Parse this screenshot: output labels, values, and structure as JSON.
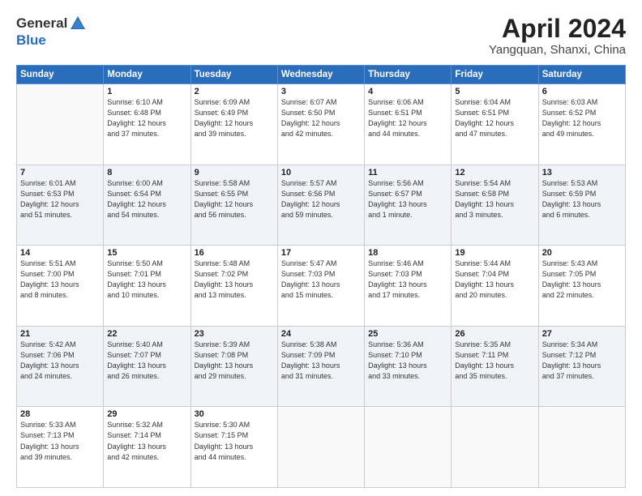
{
  "logo": {
    "general": "General",
    "blue": "Blue"
  },
  "header": {
    "month": "April 2024",
    "location": "Yangquan, Shanxi, China"
  },
  "weekdays": [
    "Sunday",
    "Monday",
    "Tuesday",
    "Wednesday",
    "Thursday",
    "Friday",
    "Saturday"
  ],
  "weeks": [
    [
      {
        "day": "",
        "info": ""
      },
      {
        "day": "1",
        "info": "Sunrise: 6:10 AM\nSunset: 6:48 PM\nDaylight: 12 hours\nand 37 minutes."
      },
      {
        "day": "2",
        "info": "Sunrise: 6:09 AM\nSunset: 6:49 PM\nDaylight: 12 hours\nand 39 minutes."
      },
      {
        "day": "3",
        "info": "Sunrise: 6:07 AM\nSunset: 6:50 PM\nDaylight: 12 hours\nand 42 minutes."
      },
      {
        "day": "4",
        "info": "Sunrise: 6:06 AM\nSunset: 6:51 PM\nDaylight: 12 hours\nand 44 minutes."
      },
      {
        "day": "5",
        "info": "Sunrise: 6:04 AM\nSunset: 6:51 PM\nDaylight: 12 hours\nand 47 minutes."
      },
      {
        "day": "6",
        "info": "Sunrise: 6:03 AM\nSunset: 6:52 PM\nDaylight: 12 hours\nand 49 minutes."
      }
    ],
    [
      {
        "day": "7",
        "info": "Sunrise: 6:01 AM\nSunset: 6:53 PM\nDaylight: 12 hours\nand 51 minutes."
      },
      {
        "day": "8",
        "info": "Sunrise: 6:00 AM\nSunset: 6:54 PM\nDaylight: 12 hours\nand 54 minutes."
      },
      {
        "day": "9",
        "info": "Sunrise: 5:58 AM\nSunset: 6:55 PM\nDaylight: 12 hours\nand 56 minutes."
      },
      {
        "day": "10",
        "info": "Sunrise: 5:57 AM\nSunset: 6:56 PM\nDaylight: 12 hours\nand 59 minutes."
      },
      {
        "day": "11",
        "info": "Sunrise: 5:56 AM\nSunset: 6:57 PM\nDaylight: 13 hours\nand 1 minute."
      },
      {
        "day": "12",
        "info": "Sunrise: 5:54 AM\nSunset: 6:58 PM\nDaylight: 13 hours\nand 3 minutes."
      },
      {
        "day": "13",
        "info": "Sunrise: 5:53 AM\nSunset: 6:59 PM\nDaylight: 13 hours\nand 6 minutes."
      }
    ],
    [
      {
        "day": "14",
        "info": "Sunrise: 5:51 AM\nSunset: 7:00 PM\nDaylight: 13 hours\nand 8 minutes."
      },
      {
        "day": "15",
        "info": "Sunrise: 5:50 AM\nSunset: 7:01 PM\nDaylight: 13 hours\nand 10 minutes."
      },
      {
        "day": "16",
        "info": "Sunrise: 5:48 AM\nSunset: 7:02 PM\nDaylight: 13 hours\nand 13 minutes."
      },
      {
        "day": "17",
        "info": "Sunrise: 5:47 AM\nSunset: 7:03 PM\nDaylight: 13 hours\nand 15 minutes."
      },
      {
        "day": "18",
        "info": "Sunrise: 5:46 AM\nSunset: 7:03 PM\nDaylight: 13 hours\nand 17 minutes."
      },
      {
        "day": "19",
        "info": "Sunrise: 5:44 AM\nSunset: 7:04 PM\nDaylight: 13 hours\nand 20 minutes."
      },
      {
        "day": "20",
        "info": "Sunrise: 5:43 AM\nSunset: 7:05 PM\nDaylight: 13 hours\nand 22 minutes."
      }
    ],
    [
      {
        "day": "21",
        "info": "Sunrise: 5:42 AM\nSunset: 7:06 PM\nDaylight: 13 hours\nand 24 minutes."
      },
      {
        "day": "22",
        "info": "Sunrise: 5:40 AM\nSunset: 7:07 PM\nDaylight: 13 hours\nand 26 minutes."
      },
      {
        "day": "23",
        "info": "Sunrise: 5:39 AM\nSunset: 7:08 PM\nDaylight: 13 hours\nand 29 minutes."
      },
      {
        "day": "24",
        "info": "Sunrise: 5:38 AM\nSunset: 7:09 PM\nDaylight: 13 hours\nand 31 minutes."
      },
      {
        "day": "25",
        "info": "Sunrise: 5:36 AM\nSunset: 7:10 PM\nDaylight: 13 hours\nand 33 minutes."
      },
      {
        "day": "26",
        "info": "Sunrise: 5:35 AM\nSunset: 7:11 PM\nDaylight: 13 hours\nand 35 minutes."
      },
      {
        "day": "27",
        "info": "Sunrise: 5:34 AM\nSunset: 7:12 PM\nDaylight: 13 hours\nand 37 minutes."
      }
    ],
    [
      {
        "day": "28",
        "info": "Sunrise: 5:33 AM\nSunset: 7:13 PM\nDaylight: 13 hours\nand 39 minutes."
      },
      {
        "day": "29",
        "info": "Sunrise: 5:32 AM\nSunset: 7:14 PM\nDaylight: 13 hours\nand 42 minutes."
      },
      {
        "day": "30",
        "info": "Sunrise: 5:30 AM\nSunset: 7:15 PM\nDaylight: 13 hours\nand 44 minutes."
      },
      {
        "day": "",
        "info": ""
      },
      {
        "day": "",
        "info": ""
      },
      {
        "day": "",
        "info": ""
      },
      {
        "day": "",
        "info": ""
      }
    ]
  ]
}
